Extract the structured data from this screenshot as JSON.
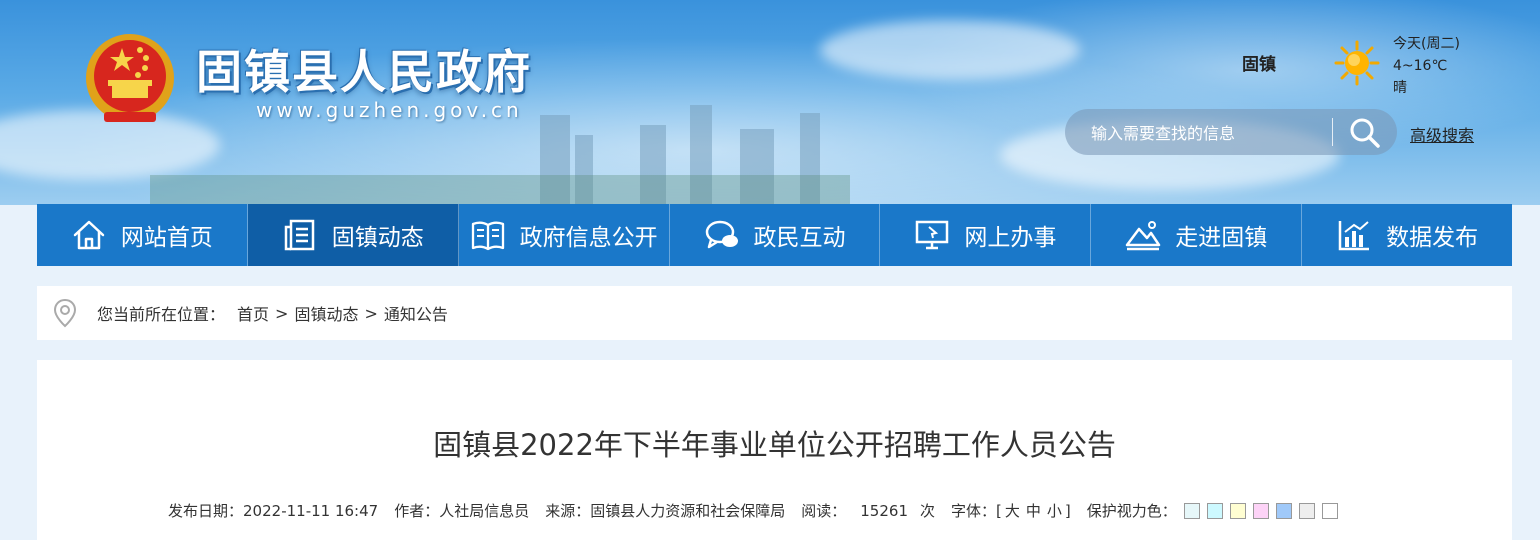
{
  "header": {
    "site_title": "固镇县人民政府",
    "site_url": "www.guzhen.gov.cn",
    "city": "固镇",
    "weather": {
      "day": "今天(周二)",
      "temp": "4~16℃",
      "condition": "晴",
      "icon": "sun-icon"
    },
    "search": {
      "placeholder": "输入需要查找的信息",
      "advanced_label": "高级搜索"
    }
  },
  "nav": {
    "items": [
      {
        "label": "网站首页",
        "icon": "home-icon"
      },
      {
        "label": "固镇动态",
        "icon": "news-icon",
        "active": true
      },
      {
        "label": "政府信息公开",
        "icon": "book-icon"
      },
      {
        "label": "政民互动",
        "icon": "chat-icon"
      },
      {
        "label": "网上办事",
        "icon": "monitor-icon"
      },
      {
        "label": "走进固镇",
        "icon": "landscape-icon"
      },
      {
        "label": "数据发布",
        "icon": "bar-chart-icon"
      }
    ]
  },
  "breadcrumb": {
    "prefix": "您当前所在位置：",
    "items": [
      "首页",
      "固镇动态",
      "通知公告"
    ],
    "separator": ">"
  },
  "article": {
    "title": "固镇县2022年下半年事业单位公开招聘工作人员公告",
    "meta": {
      "date_label": "发布日期：",
      "date": "2022-11-11 16:47",
      "author_label": "作者：",
      "author": "人社局信息员",
      "source_label": "来源：",
      "source": "固镇县人力资源和社会保障局",
      "reads_label": "阅读：",
      "reads": "15261",
      "reads_unit": "次",
      "font_label": "字体：",
      "font_open": "[",
      "font_sizes": [
        "大",
        "中",
        "小"
      ],
      "font_close": "]",
      "eye_label": "保护视力色：",
      "eye_colors": [
        "#e6f7f9",
        "#cdf9ff",
        "#fffed2",
        "#fdd3f7",
        "#a0c9f9",
        "#eeeeee",
        "#ffffff"
      ]
    }
  }
}
